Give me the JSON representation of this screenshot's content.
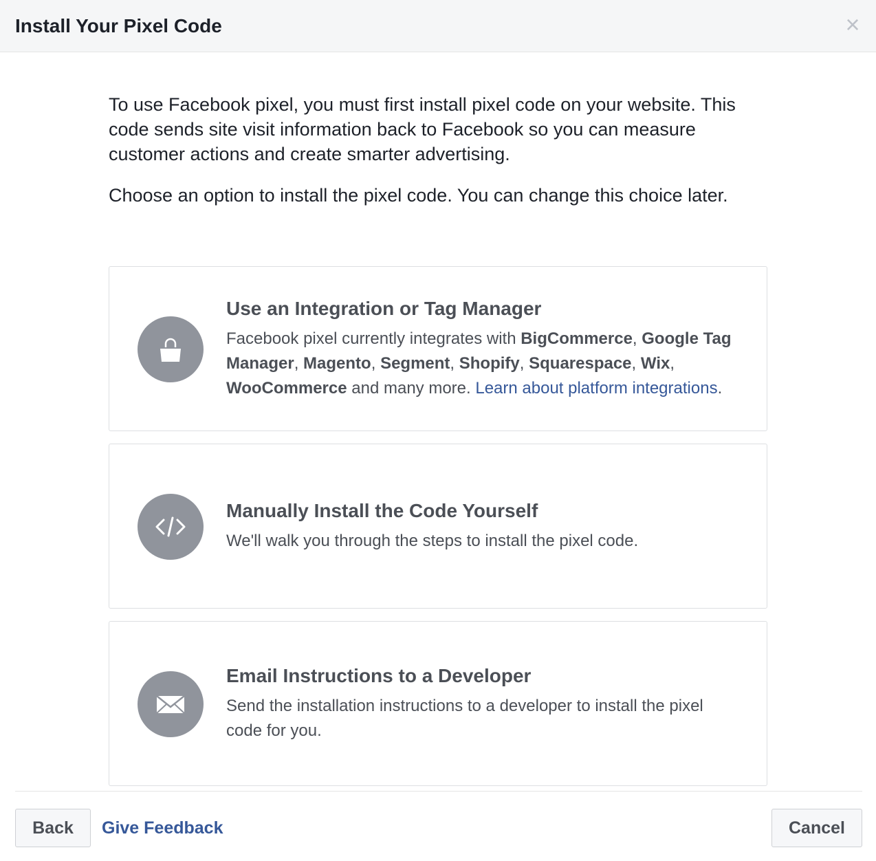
{
  "dialog": {
    "title": "Install Your Pixel Code",
    "close_icon": "×"
  },
  "intro": {
    "paragraph1": "To use Facebook pixel, you must first install pixel code on your website. This code sends site visit information back to Facebook so you can measure customer actions and create smarter advertising.",
    "paragraph2": "Choose an option to install the pixel code. You can change this choice later."
  },
  "options": [
    {
      "icon": "shopping-bag-icon",
      "title": "Use an Integration or Tag Manager",
      "desc_prefix": "Facebook pixel currently integrates with ",
      "platforms": [
        "BigCommerce",
        "Google Tag Manager",
        "Magento",
        "Segment",
        "Shopify",
        "Squarespace",
        "Wix",
        "WooCommerce"
      ],
      "sep": ", ",
      "desc_suffix": " and many more. ",
      "link_text": "Learn about platform integrations",
      "link_end": "."
    },
    {
      "icon": "code-icon",
      "title": "Manually Install the Code Yourself",
      "description": "We'll walk you through the steps to install the pixel code."
    },
    {
      "icon": "envelope-icon",
      "title": "Email Instructions to a Developer",
      "description": "Send the installation instructions to a developer to install the pixel code for you."
    }
  ],
  "footer": {
    "back_label": "Back",
    "feedback_label": "Give Feedback",
    "cancel_label": "Cancel"
  },
  "colors": {
    "link": "#365899",
    "icon_circle": "#90949c",
    "header_bg": "#f5f6f7"
  }
}
